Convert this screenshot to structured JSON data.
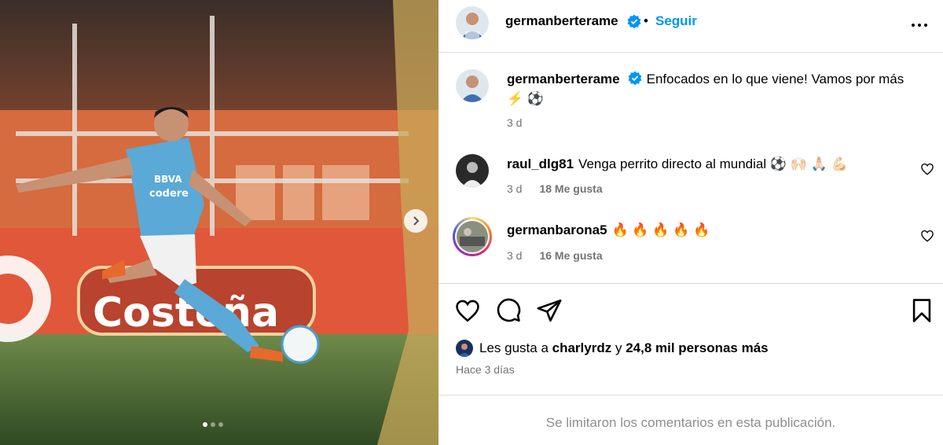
{
  "post": {
    "carousel": {
      "slide_count": 3,
      "active_index": 0
    },
    "header": {
      "username": "germanberterame",
      "separator": "•",
      "follow_label": "Seguir"
    },
    "caption": {
      "username": "germanberterame",
      "text": "Enfocados en lo que viene! Vamos por más",
      "emojis": "⚡ ⚽",
      "time": "3 d"
    },
    "comments": [
      {
        "username": "raul_dlg81",
        "text": "Venga perrito directo al mundial ⚽ 🙌🏻 🙏🏻 💪🏻",
        "time": "3 d",
        "likes": "18 Me gusta"
      },
      {
        "username": "germanbarona5",
        "text": "🔥 🔥 🔥 🔥 🔥",
        "time": "3 d",
        "likes": "16 Me gusta"
      }
    ],
    "likes": {
      "prefix": "Les gusta a",
      "user": "charlyrdz",
      "connector": "y",
      "others": "24,8 mil personas más"
    },
    "posted_ago": "Hace 3 días",
    "comments_limited": "Se limitaron los comentarios en esta publicación."
  },
  "colors": {
    "accent": "#0095f6",
    "muted": "#737373",
    "border": "#dbdbdb"
  }
}
